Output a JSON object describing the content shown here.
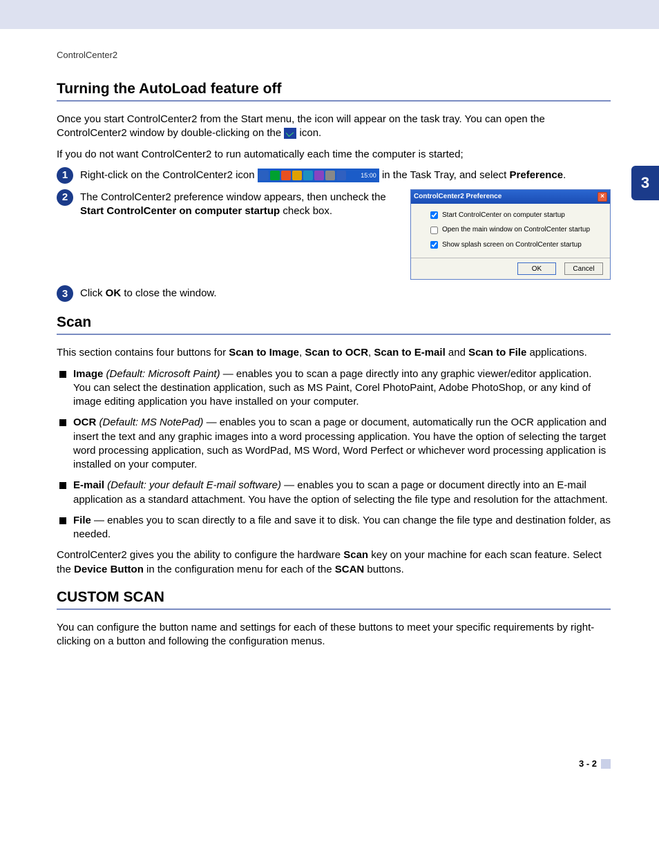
{
  "header": "ControlCenter2",
  "chapter_tab": "3",
  "page_number": "3 - 2",
  "sections": {
    "autoload": {
      "title": "Turning the AutoLoad feature off",
      "p1a": "Once you start ControlCenter2 from the Start menu, the icon will appear on the task tray. You can open the ControlCenter2 window by double-clicking on the ",
      "p1b": " icon.",
      "p2": "If you do not want ControlCenter2 to run automatically each time the computer is started;",
      "steps": {
        "s1a": "Right-click on the ControlCenter2 icon ",
        "s1b": " in the Task Tray, and select ",
        "s1c": "Preference",
        "s1d": ".",
        "s2a": "The ControlCenter2 preference window appears, then uncheck the ",
        "s2b": "Start ControlCenter on computer startup",
        "s2c": " check box.",
        "s3a": "Click ",
        "s3b": "OK",
        "s3c": " to close the window."
      }
    },
    "scan": {
      "title": "Scan",
      "intro_a": "This section contains four buttons for ",
      "intro_b1": "Scan to Image",
      "intro_c1": ", ",
      "intro_b2": "Scan to OCR",
      "intro_c2": ", ",
      "intro_b3": "Scan to E-mail",
      "intro_c3": " and ",
      "intro_b4": "Scan to File",
      "intro_c4": " applications.",
      "items": {
        "image_label": "Image",
        "image_default": " (Default: Microsoft Paint)",
        "image_text": " — enables you to scan a page directly into any graphic viewer/editor application. You can select the destination application, such as MS Paint, Corel PhotoPaint, Adobe PhotoShop, or any kind of image editing application you have installed on your computer.",
        "ocr_label": "OCR",
        "ocr_default": " (Default: MS NotePad)",
        "ocr_text": " — enables you to scan a page or document, automatically run the OCR application and insert the text and any graphic images into a word processing application. You have the option of selecting the target word processing application, such as WordPad, MS Word, Word Perfect or whichever word processing application is installed on your computer.",
        "email_label": "E-mail",
        "email_default": " (Default: your default E-mail software)",
        "email_text": " — enables you to scan a page or document directly into an E-mail application as a standard attachment. You have the option of selecting the file type and resolution for the attachment.",
        "file_label": "File",
        "file_text": " — enables you to scan directly to a file and save it to disk. You can change the file type and destination folder, as needed."
      },
      "footer_a": "ControlCenter2 gives you the ability to configure the hardware ",
      "footer_b": "Scan",
      "footer_c": " key on your machine for each scan feature. Select the ",
      "footer_d": "Device Button",
      "footer_e": " in the configuration menu for each of the ",
      "footer_f": "SCAN",
      "footer_g": " buttons."
    },
    "custom": {
      "title": "CUSTOM SCAN",
      "text": "You can configure the button name and settings for each of these buttons to meet your specific requirements by right-clicking on a button and following the configuration menus."
    }
  },
  "dialog": {
    "title": "ControlCenter2  Preference",
    "opt1": "Start ControlCenter on computer startup",
    "opt2": "Open the main window on ControlCenter startup",
    "opt3": "Show splash screen on ControlCenter startup",
    "ok": "OK",
    "cancel": "Cancel",
    "opt1_checked": true,
    "opt2_checked": false,
    "opt3_checked": true
  },
  "tray_time": "15:00"
}
